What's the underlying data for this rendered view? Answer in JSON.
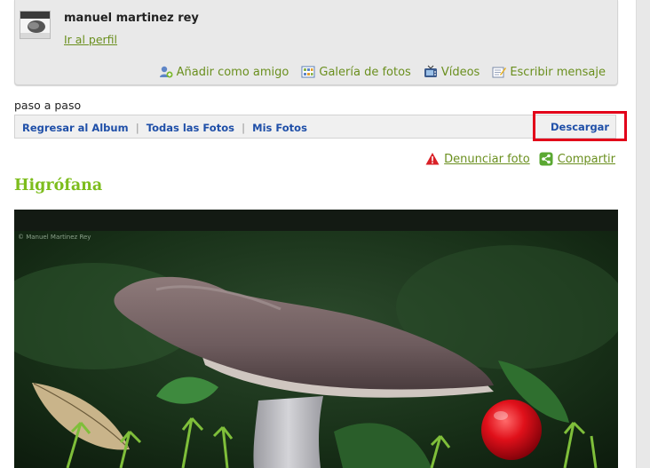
{
  "profile": {
    "name": "manuel martinez rey",
    "link": "Ir al perfil",
    "actions": [
      {
        "label": "Añadir como amigo",
        "icon": "add-friend-icon"
      },
      {
        "label": "Galería de fotos",
        "icon": "gallery-icon"
      },
      {
        "label": "Vídeos",
        "icon": "tv-icon"
      },
      {
        "label": "Escribir mensaje",
        "icon": "message-icon"
      }
    ]
  },
  "album": {
    "title": "paso a paso",
    "nav": [
      "Regresar al Album",
      "Todas las Fotos",
      "Mis Fotos"
    ],
    "download": "Descargar"
  },
  "photo_actions": {
    "report": "Denunciar foto",
    "share": "Compartir"
  },
  "photo": {
    "title": "Higrófana",
    "watermark": "© Manuel Martinez Rey"
  },
  "colors": {
    "link_green": "#6a8f1e",
    "title_green": "#7dbd1d",
    "nav_blue": "#1f4fa8",
    "highlight_red": "#e2001a"
  }
}
